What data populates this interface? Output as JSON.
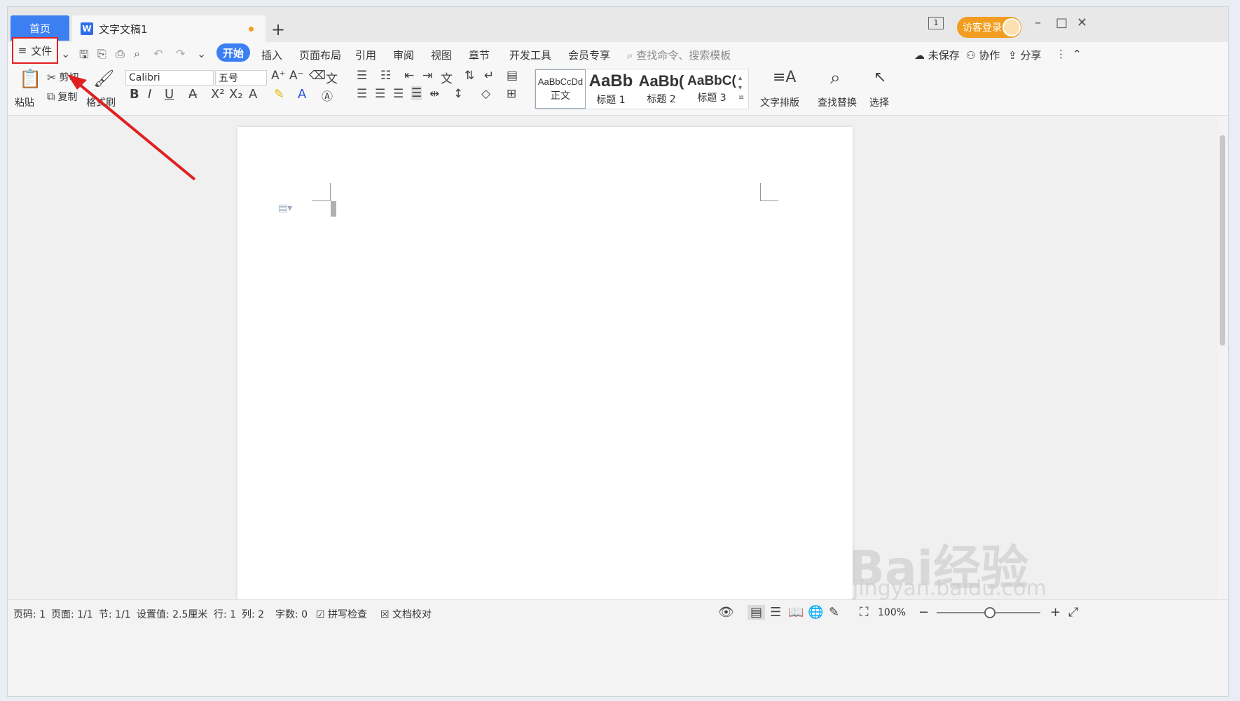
{
  "tabs": {
    "home": "首页",
    "doc": "文字文稿1",
    "add": "+"
  },
  "titlebar": {
    "page_badge": "1",
    "login": "访客登录",
    "minimize": "–",
    "maximize": "□",
    "close": "✕"
  },
  "menu": {
    "file": "文件",
    "start": "开始",
    "items": [
      "插入",
      "页面布局",
      "引用",
      "审阅",
      "视图",
      "章节",
      "开发工具",
      "会员专享"
    ],
    "search_placeholder": "查找命令、搜索模板",
    "unsaved": "未保存",
    "collab": "协作",
    "share": "分享"
  },
  "ribbon": {
    "paste": "粘贴",
    "cut": "剪切",
    "copy": "复制",
    "format_painter": "格式刷",
    "font": "Calibri",
    "size": "五号",
    "styles": [
      {
        "preview": "AaBbCcDd",
        "name": "正文"
      },
      {
        "preview": "AaBb",
        "name": "标题 1"
      },
      {
        "preview": "AaBb(",
        "name": "标题 2"
      },
      {
        "preview": "AaBbC(",
        "name": "标题 3"
      }
    ],
    "text_layout": "文字排版",
    "find_replace": "查找替换",
    "select": "选择"
  },
  "status": {
    "page_num": "页码: 1",
    "pages": "页面: 1/1",
    "section": "节: 1/1",
    "setting": "设置值: 2.5厘米",
    "row": "行: 1",
    "col": "列: 2",
    "words": "字数: 0",
    "spell": "拼写检查",
    "proof": "文档校对",
    "zoom": "100%",
    "zoom_minus": "−",
    "zoom_plus": "+"
  },
  "watermark": {
    "main": "Bai经验",
    "sub": "jingyan.baidu.com"
  },
  "colors": {
    "accent": "#3c7ff3",
    "highlight_box": "#e02020",
    "arrow": "#e02020",
    "login": "#f29d1f"
  }
}
